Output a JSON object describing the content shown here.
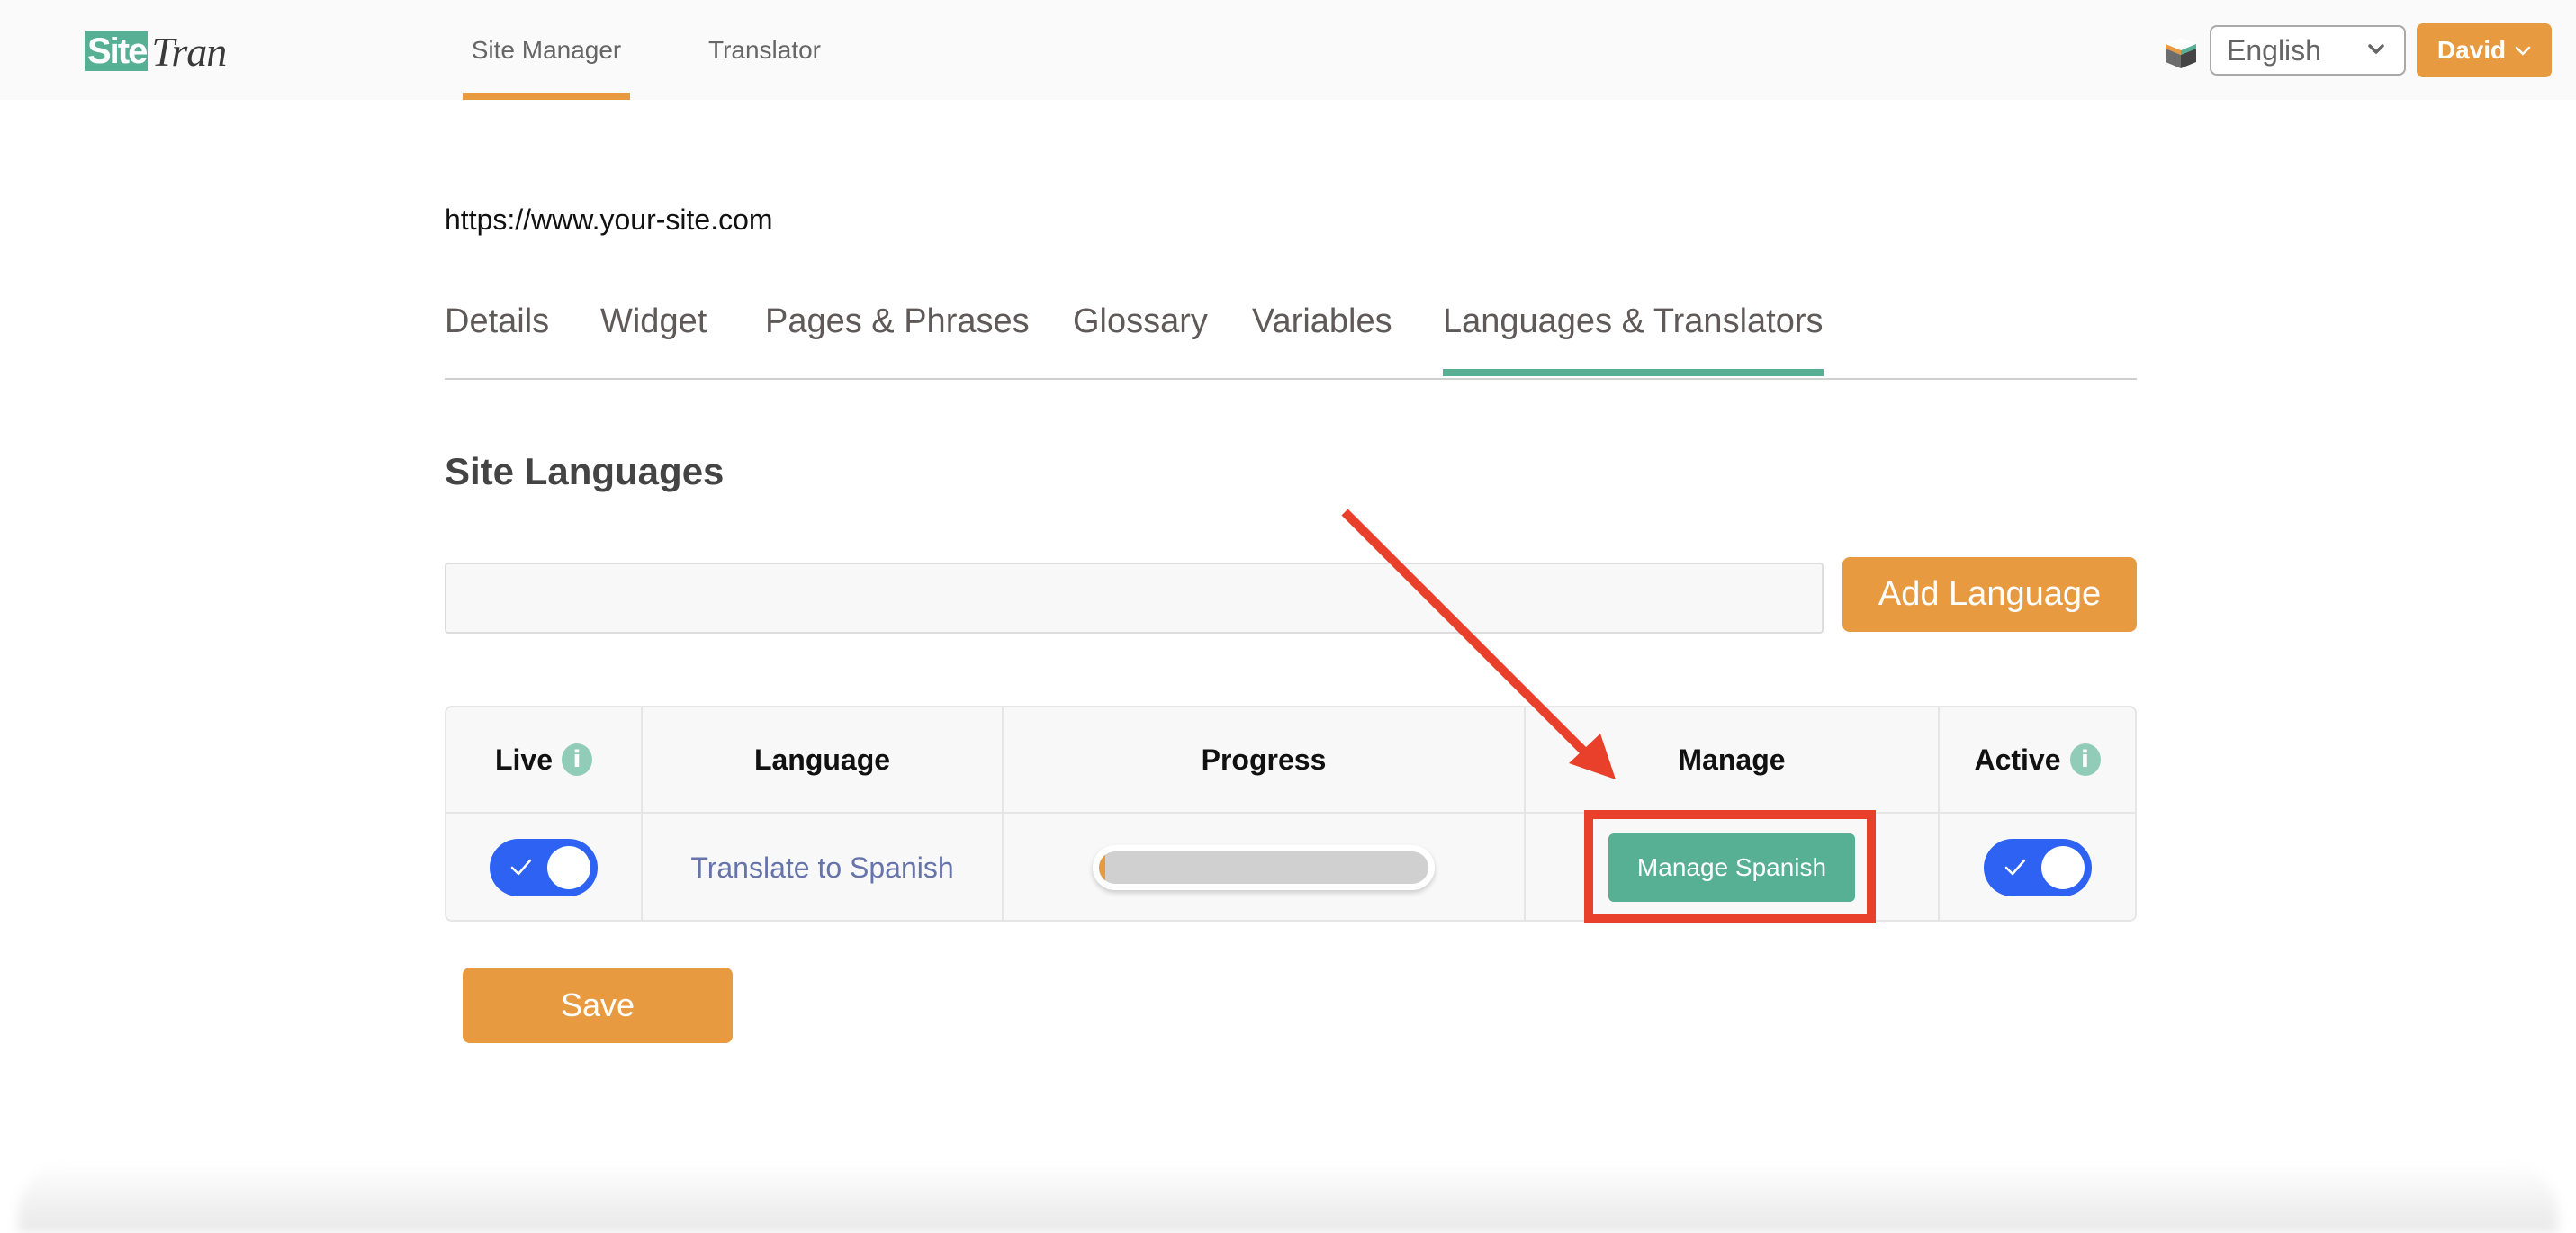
{
  "header": {
    "logo": {
      "part1": "Site",
      "part2": "Tran"
    },
    "nav": [
      {
        "label": "Site Manager",
        "active": true
      },
      {
        "label": "Translator",
        "active": false
      }
    ],
    "language_select": {
      "value": "English"
    },
    "user_menu": {
      "label": "David"
    }
  },
  "site": {
    "url": "https://www.your-site.com"
  },
  "tabs": [
    {
      "label": "Details",
      "active": false
    },
    {
      "label": "Widget",
      "active": false
    },
    {
      "label": "Pages & Phrases",
      "active": false
    },
    {
      "label": "Glossary",
      "active": false
    },
    {
      "label": "Variables",
      "active": false
    },
    {
      "label": "Languages & Translators",
      "active": true
    }
  ],
  "section": {
    "title": "Site Languages",
    "add_input": {
      "value": "",
      "placeholder": ""
    },
    "add_button": "Add Language"
  },
  "table": {
    "columns": [
      {
        "label": "Live",
        "info": true
      },
      {
        "label": "Language",
        "info": false
      },
      {
        "label": "Progress",
        "info": false
      },
      {
        "label": "Manage",
        "info": false
      },
      {
        "label": "Active",
        "info": true
      }
    ],
    "rows": [
      {
        "live": true,
        "language_link": "Translate to Spanish",
        "progress_percent": 2,
        "manage_button": "Manage Spanish",
        "active": true
      }
    ]
  },
  "info_glyph": "i",
  "save_button": "Save",
  "colors": {
    "brand_green": "#57b094",
    "accent_orange": "#e89a40",
    "toggle_blue": "#2e62f2",
    "annotation_red": "#e8402a"
  },
  "annotation": {
    "highlight_target": "manage-spanish-button",
    "arrow": true
  }
}
